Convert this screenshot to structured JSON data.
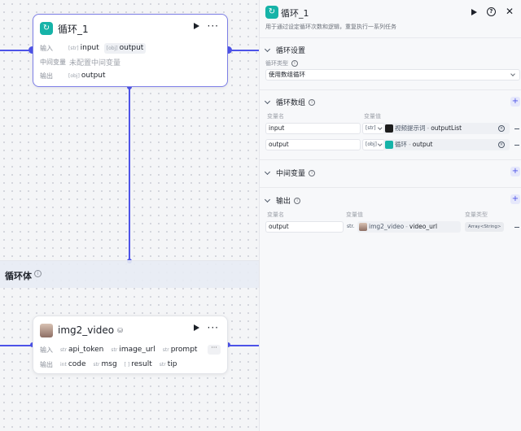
{
  "canvas": {
    "loop_node": {
      "title": "循环_1",
      "input_label": "输入",
      "input_param": "input",
      "input_param_type": "[str]",
      "output_chip": "output",
      "output_chip_type": "[obj]",
      "intermediate_label": "中间变量",
      "intermediate_value": "未配置中间变量",
      "output_label": "输出",
      "output_param": "output",
      "output_param_type": "[obj]"
    },
    "loop_body": {
      "title": "循环体",
      "info_icon": "info-icon"
    },
    "video_node": {
      "title": "img2_video",
      "input_label": "输入",
      "inputs": [
        {
          "type": "str",
          "name": "api_token"
        },
        {
          "type": "str",
          "name": "image_url"
        },
        {
          "type": "str",
          "name": "prompt"
        }
      ],
      "more_label": "···",
      "output_label": "输出",
      "outputs": [
        {
          "type": "int",
          "name": "code"
        },
        {
          "type": "str",
          "name": "msg"
        },
        {
          "type": "[ ]",
          "name": "result"
        },
        {
          "type": "str",
          "name": "tip"
        }
      ]
    }
  },
  "panel": {
    "title": "循环_1",
    "description": "用于通过设定循环次数和逻辑，重复执行一系列任务",
    "loop_settings": {
      "title": "循环设置",
      "type_label": "循环类型",
      "type_value": "使用数组循环"
    },
    "loop_array": {
      "title": "循环数组",
      "col_name": "变量名",
      "col_value": "变量值",
      "rows": [
        {
          "name": "input",
          "type": "[str]",
          "node": "视频提示词",
          "field": "outputList"
        },
        {
          "name": "output",
          "type": "[obj]",
          "node": "循环",
          "field": "output"
        }
      ]
    },
    "intermediate": {
      "title": "中间变量"
    },
    "output": {
      "title": "输出",
      "col_name": "变量名",
      "col_value": "变量值",
      "col_type": "变量类型",
      "rows": [
        {
          "name": "output",
          "str_prefix": "str.",
          "node": "img2_video",
          "field": "video_url",
          "var_type": "Array<String>"
        }
      ]
    },
    "colors": {
      "accent": "#4d53e8",
      "loop_logo": "#16b3a8"
    }
  }
}
